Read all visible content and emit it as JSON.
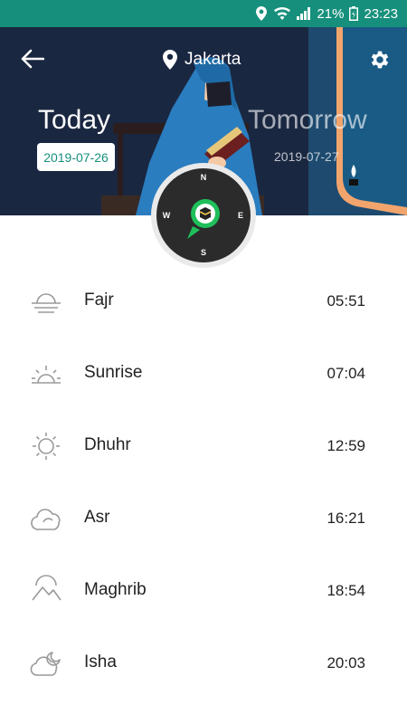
{
  "status_bar": {
    "battery_percent": "21%",
    "time": "23:23",
    "icons": [
      "location-icon",
      "wifi-icon",
      "signal-icon",
      "battery-icon"
    ]
  },
  "header": {
    "location": "Jakarta",
    "today_label": "Today",
    "today_date": "2019-07-26",
    "tomorrow_label": "Tomorrow",
    "tomorrow_date": "2019-07-27",
    "icons": [
      "back-arrow-icon",
      "location-pin-icon",
      "settings-gear-icon"
    ]
  },
  "compass": {
    "north": "N",
    "south": "S",
    "east": "E",
    "west": "W",
    "icon": "kaaba-icon"
  },
  "prayers": [
    {
      "name": "Fajr",
      "time": "05:51",
      "icon": "horizon-icon"
    },
    {
      "name": "Sunrise",
      "time": "07:04",
      "icon": "sunrise-icon"
    },
    {
      "name": "Dhuhr",
      "time": "12:59",
      "icon": "sun-icon"
    },
    {
      "name": "Asr",
      "time": "16:21",
      "icon": "cloud-icon"
    },
    {
      "name": "Maghrib",
      "time": "18:54",
      "icon": "mountains-icon"
    },
    {
      "name": "Isha",
      "time": "20:03",
      "icon": "moon-cloud-icon"
    }
  ],
  "colors": {
    "status_bar": "#16907c",
    "header_bg": "#1a2741",
    "accent": "#16907c",
    "text": "#222222"
  }
}
